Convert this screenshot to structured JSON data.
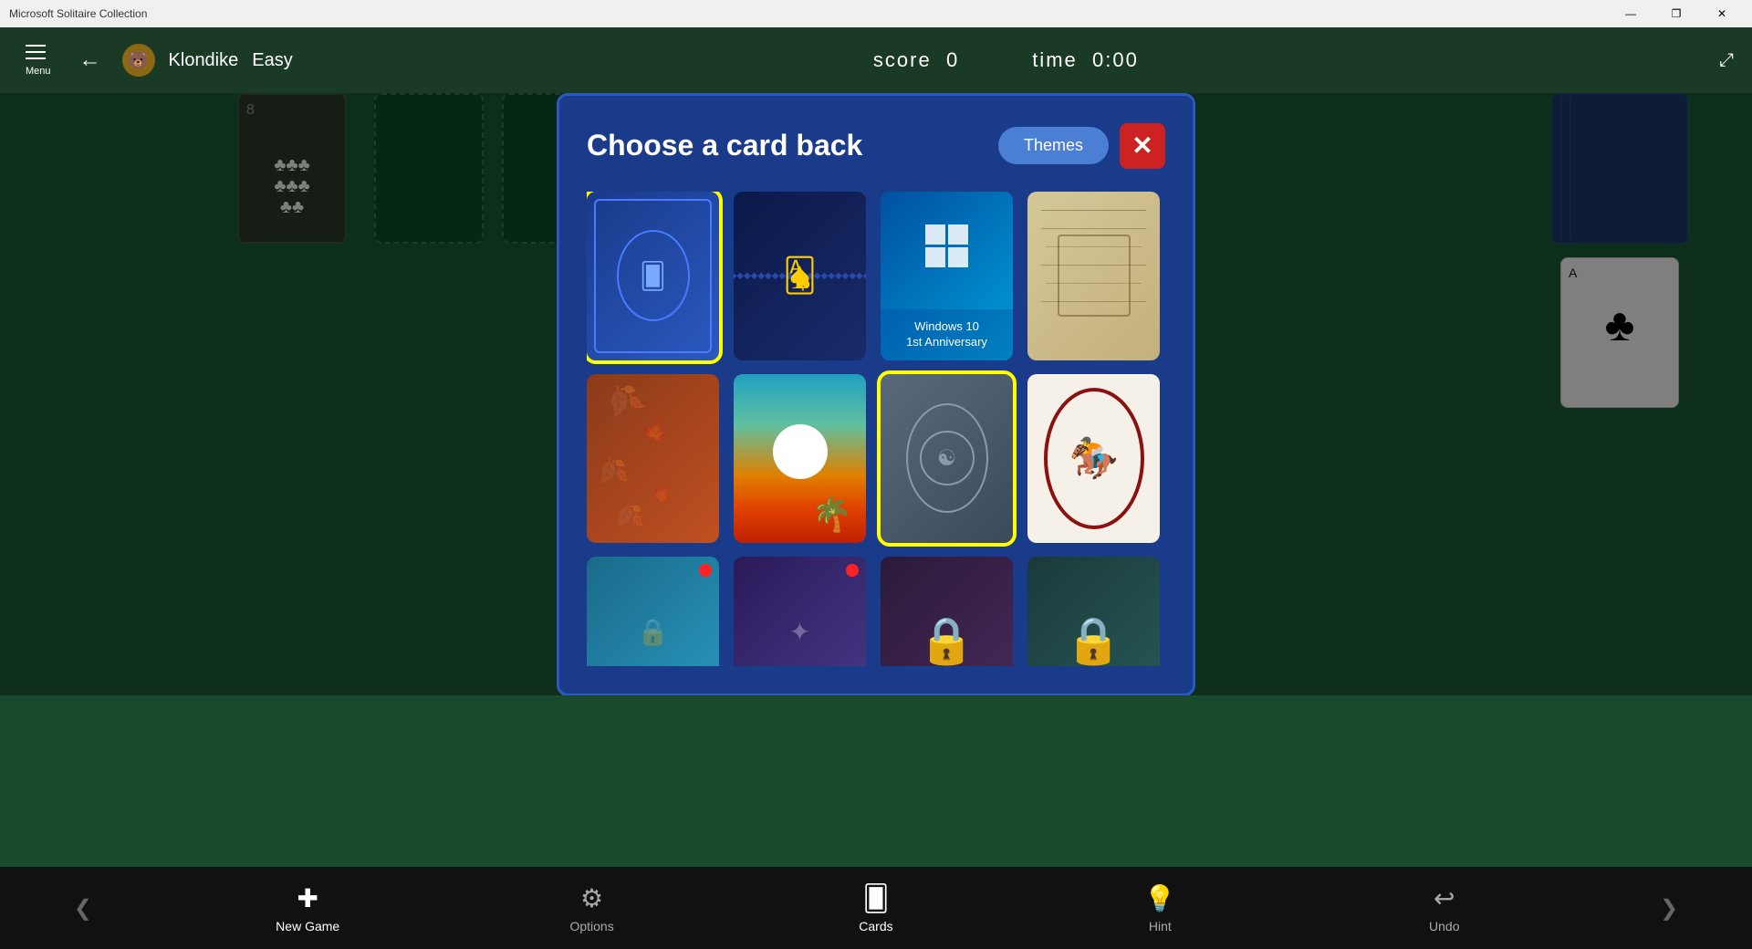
{
  "titleBar": {
    "title": "Microsoft Solitaire Collection",
    "minimize": "—",
    "restore": "❐",
    "close": "✕"
  },
  "toolbar": {
    "menu": "Menu",
    "back": "←",
    "gameName": "Klondike",
    "difficulty": "Easy",
    "scoreLabel": "score",
    "scoreValue": "0",
    "timeLabel": "time",
    "timeValue": "0:00"
  },
  "modal": {
    "title": "Choose a card back",
    "themesButton": "Themes",
    "closeButton": "✕"
  },
  "cards": [
    {
      "id": "blue-ornate",
      "label": "Blue Ornate",
      "type": "blue-ornate",
      "selected": true,
      "locked": false,
      "isNew": false
    },
    {
      "id": "dark-diamonds",
      "label": "Dark Diamonds",
      "type": "dark-diamonds",
      "selected": false,
      "locked": false,
      "isNew": false
    },
    {
      "id": "windows10",
      "label": "Windows 10 1st Anniversary",
      "type": "windows10",
      "selected": false,
      "locked": false,
      "isNew": false
    },
    {
      "id": "parchment",
      "label": "Parchment",
      "type": "parchment",
      "selected": false,
      "locked": false,
      "isNew": false
    },
    {
      "id": "autumn",
      "label": "Autumn Leaves",
      "type": "autumn",
      "selected": false,
      "locked": false,
      "isNew": false
    },
    {
      "id": "sunset",
      "label": "Sunset Beach",
      "type": "sunset",
      "selected": false,
      "locked": false,
      "isNew": false
    },
    {
      "id": "gray-ornate",
      "label": "Gray Ornate",
      "type": "gray-ornate",
      "selected": true,
      "locked": false,
      "isNew": false
    },
    {
      "id": "red-knight",
      "label": "Red Knight",
      "type": "red-ornate",
      "selected": false,
      "locked": false,
      "isNew": false
    },
    {
      "id": "teal-new",
      "label": "Teal New",
      "type": "teal-new",
      "selected": false,
      "locked": false,
      "isNew": true
    },
    {
      "id": "purple-new",
      "label": "Purple New",
      "type": "purple-new",
      "selected": false,
      "locked": false,
      "isNew": true
    },
    {
      "id": "dark-purple-locked",
      "label": "Dark Purple Locked",
      "type": "dark-purple",
      "selected": false,
      "locked": true,
      "isNew": false
    },
    {
      "id": "dark-teal-locked",
      "label": "Dark Teal Locked",
      "type": "dark-teal",
      "selected": false,
      "locked": true,
      "isNew": false
    }
  ],
  "bottomBar": {
    "items": [
      {
        "id": "new-game",
        "label": "New Game",
        "icon": "+"
      },
      {
        "id": "options",
        "label": "Options",
        "icon": "⚙"
      },
      {
        "id": "cards",
        "label": "Cards",
        "icon": "🃏"
      },
      {
        "id": "hint",
        "label": "Hint",
        "icon": "💡"
      },
      {
        "id": "undo",
        "label": "Undo",
        "icon": "↩"
      }
    ],
    "leftArrow": "❮",
    "rightArrow": "❯"
  }
}
